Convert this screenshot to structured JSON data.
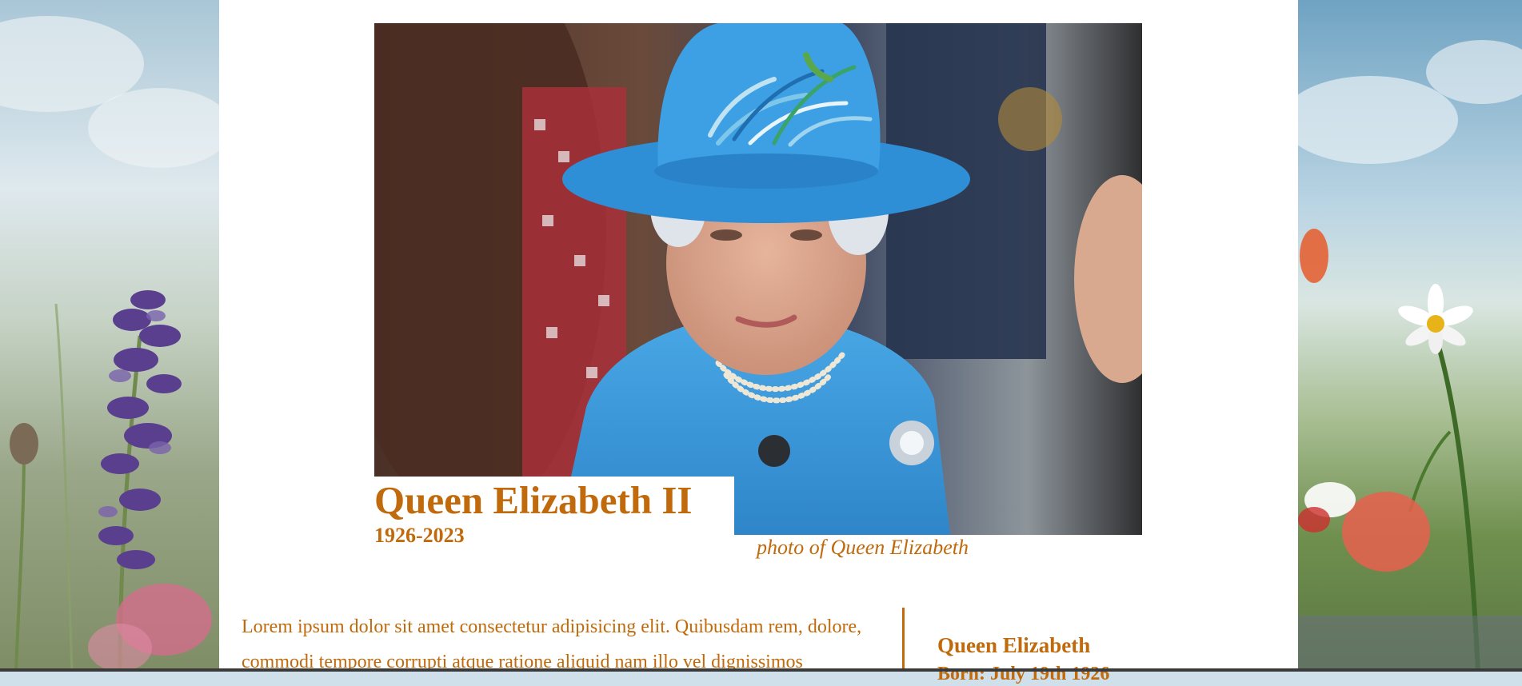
{
  "memorial": {
    "name": "Queen Elizabeth II",
    "years": "1926-2023",
    "photo_caption": "photo of Queen Elizabeth"
  },
  "article": {
    "text": "Lorem ipsum dolor sit amet consectetur adipisicing elit. Quibusdam rem, dolore, commodi tempore corrupti atque ratione aliquid nam illo vel dignissimos"
  },
  "sidebar": {
    "title": "Queen Elizabeth",
    "subtitle": "Born: July 19th 1926"
  },
  "colors": {
    "accent": "#c06a0c",
    "page_background": "#ffffff",
    "hat_and_coat": "#3a97d9"
  }
}
